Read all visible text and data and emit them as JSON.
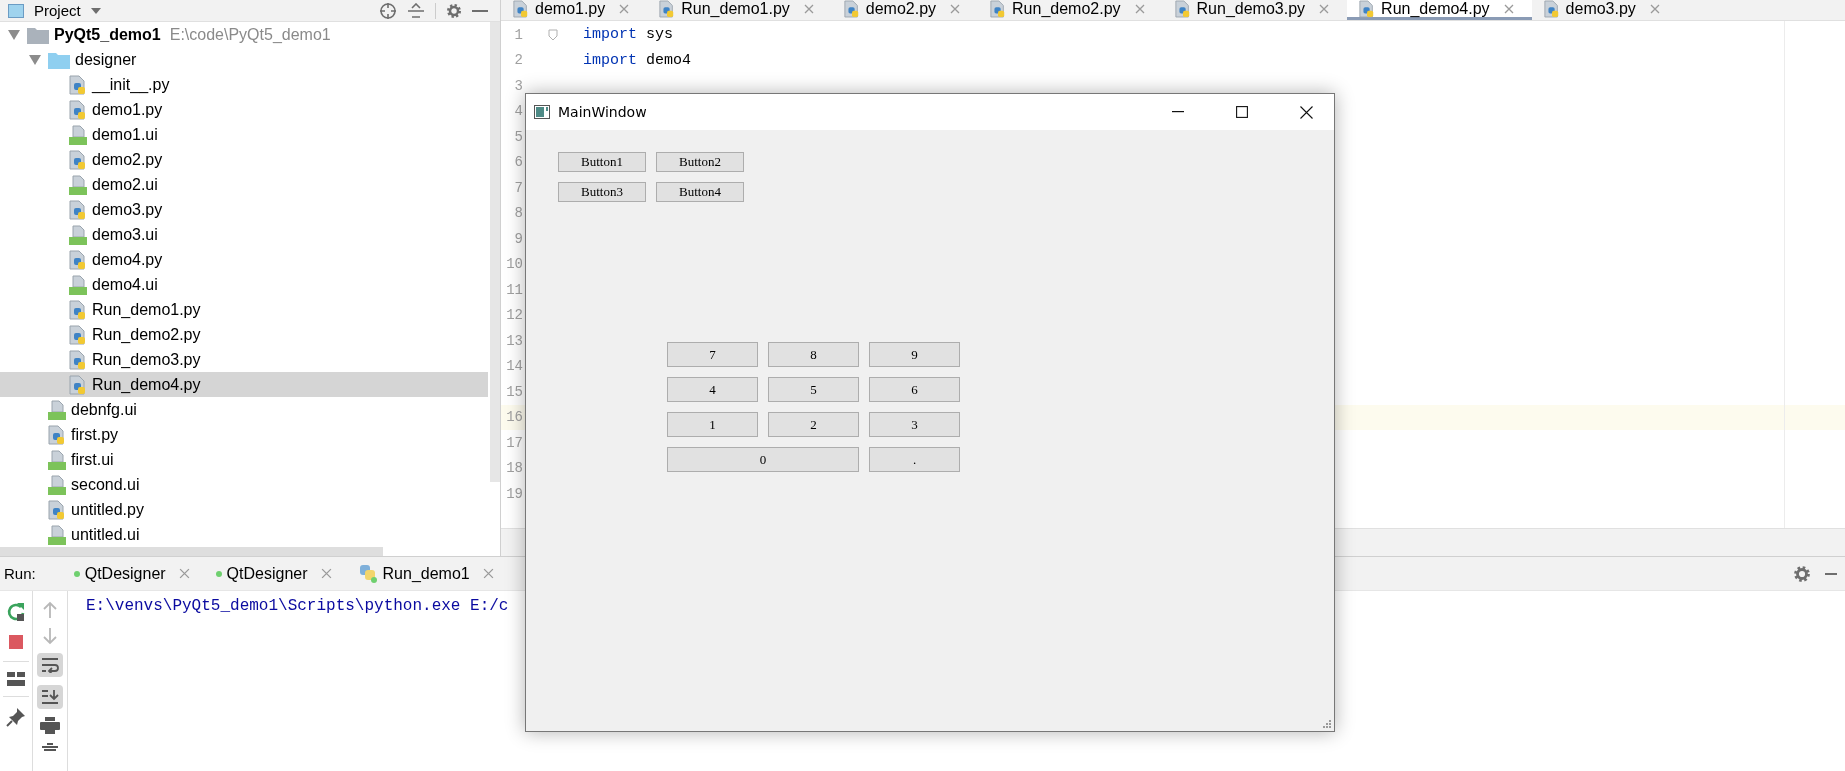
{
  "project": {
    "title": "Project",
    "tree": [
      {
        "name": "PyQt5_demo1",
        "path": "E:\\code\\PyQt5_demo1",
        "kind": "module",
        "expanded": true,
        "selected": false,
        "children": [
          {
            "name": "designer",
            "kind": "folder",
            "expanded": true,
            "selected": false,
            "children": [
              {
                "name": "__init__.py",
                "kind": "py",
                "selected": false
              },
              {
                "name": "demo1.py",
                "kind": "py",
                "selected": false
              },
              {
                "name": "demo1.ui",
                "kind": "ui",
                "selected": false
              },
              {
                "name": "demo2.py",
                "kind": "py",
                "selected": false
              },
              {
                "name": "demo2.ui",
                "kind": "ui",
                "selected": false
              },
              {
                "name": "demo3.py",
                "kind": "py",
                "selected": false
              },
              {
                "name": "demo3.ui",
                "kind": "ui",
                "selected": false
              },
              {
                "name": "demo4.py",
                "kind": "py",
                "selected": false
              },
              {
                "name": "demo4.ui",
                "kind": "ui",
                "selected": false
              },
              {
                "name": "Run_demo1.py",
                "kind": "py",
                "selected": false
              },
              {
                "name": "Run_demo2.py",
                "kind": "py",
                "selected": false
              },
              {
                "name": "Run_demo3.py",
                "kind": "py",
                "selected": false
              },
              {
                "name": "Run_demo4.py",
                "kind": "py",
                "selected": true
              }
            ]
          },
          {
            "name": "debnfg.ui",
            "kind": "ui",
            "selected": false
          },
          {
            "name": "first.py",
            "kind": "py",
            "selected": false
          },
          {
            "name": "first.ui",
            "kind": "ui",
            "selected": false
          },
          {
            "name": "second.ui",
            "kind": "ui",
            "selected": false
          },
          {
            "name": "untitled.py",
            "kind": "py",
            "selected": false
          },
          {
            "name": "untitled.ui",
            "kind": "ui",
            "selected": false
          }
        ]
      }
    ]
  },
  "editor": {
    "tabs": [
      {
        "label": "demo1.py",
        "selected": false
      },
      {
        "label": "Run_demo1.py",
        "selected": false
      },
      {
        "label": "demo2.py",
        "selected": false
      },
      {
        "label": "Run_demo2.py",
        "selected": false
      },
      {
        "label": "Run_demo3.py",
        "selected": false
      },
      {
        "label": "Run_demo4.py",
        "selected": true
      },
      {
        "label": "demo3.py",
        "selected": false
      }
    ],
    "lines": [
      {
        "number": "1",
        "current": false,
        "tokens": [
          {
            "kind": "keyword",
            "text": "import"
          },
          {
            "kind": "plain",
            "text": "sys"
          }
        ]
      },
      {
        "number": "2",
        "current": false,
        "tokens": [
          {
            "kind": "keyword",
            "text": "import"
          },
          {
            "kind": "plain",
            "text": "demo4"
          }
        ]
      },
      {
        "number": "3",
        "current": false
      },
      {
        "number": "4",
        "current": false
      },
      {
        "number": "5",
        "current": false
      },
      {
        "number": "6",
        "current": false
      },
      {
        "number": "7",
        "current": false
      },
      {
        "number": "8",
        "current": false
      },
      {
        "number": "9",
        "current": false
      },
      {
        "number": "10",
        "current": false
      },
      {
        "number": "11",
        "current": false
      },
      {
        "number": "12",
        "current": false
      },
      {
        "number": "13",
        "current": false
      },
      {
        "number": "14",
        "current": false
      },
      {
        "number": "15",
        "current": false
      },
      {
        "number": "16",
        "current": true
      },
      {
        "number": "17",
        "current": false
      },
      {
        "number": "18",
        "current": false
      },
      {
        "number": "19",
        "current": false
      }
    ]
  },
  "run": {
    "label": "Run:",
    "tabs": [
      {
        "label": "QtDesigner",
        "kind": "qt"
      },
      {
        "label": "QtDesigner",
        "kind": "qt"
      },
      {
        "label": "Run_demo1",
        "kind": "python"
      }
    ],
    "soft_wrap_on": true,
    "scroll_to_end_on": true,
    "console": [
      "E:\\venvs\\PyQt5_demo1\\Scripts\\python.exe E:/c"
    ]
  },
  "main_window": {
    "title": "MainWindow",
    "buttons": [
      "Button1",
      "Button2",
      "Button3",
      "Button4"
    ],
    "keypad": [
      {
        "label": "7",
        "wide": false
      },
      {
        "label": "8",
        "wide": false
      },
      {
        "label": "9",
        "wide": false
      },
      {
        "label": "4",
        "wide": false
      },
      {
        "label": "5",
        "wide": false
      },
      {
        "label": "6",
        "wide": false
      },
      {
        "label": "1",
        "wide": false
      },
      {
        "label": "2",
        "wide": false
      },
      {
        "label": "3",
        "wide": false
      },
      {
        "label": "0",
        "wide": true
      },
      {
        "label": ".",
        "wide": false
      }
    ]
  }
}
